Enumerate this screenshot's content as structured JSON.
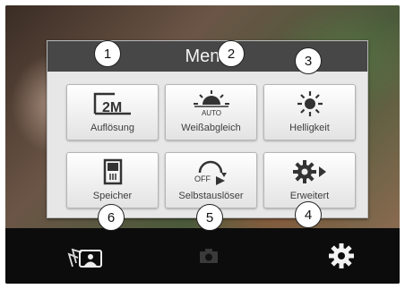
{
  "menu": {
    "title": "Menü",
    "buttons": [
      {
        "label": "Auflösung",
        "icon_text": "2M",
        "icon": "resolution-icon"
      },
      {
        "label": "Weißabgleich",
        "icon_text": "AUTO",
        "icon": "white-balance-icon"
      },
      {
        "label": "Helligkeit",
        "icon": "brightness-icon"
      },
      {
        "label": "Speicher",
        "icon": "memory-card-icon"
      },
      {
        "label": "Selbstauslöser",
        "icon_text": "OFF",
        "icon": "self-timer-icon"
      },
      {
        "label": "Erweitert",
        "icon": "advanced-gear-icon"
      }
    ]
  },
  "callouts": [
    "1",
    "2",
    "3",
    "4",
    "5",
    "6"
  ],
  "bottom_bar": {
    "left_icon": "gallery-icon",
    "center_icon": "camera-icon",
    "right_icon": "settings-gear-icon"
  }
}
